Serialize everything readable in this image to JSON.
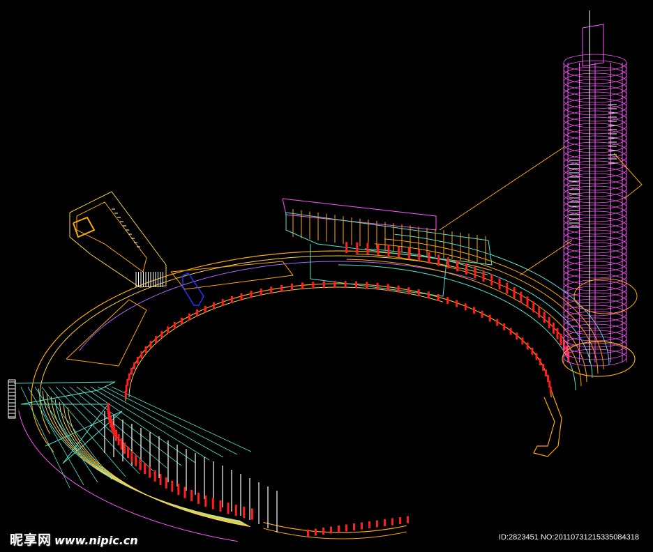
{
  "watermark": {
    "logo_text": "昵享网",
    "site_text": "www.nipic.cn",
    "id_text": "ID:2823451 NO:20110731215335084318"
  },
  "colors": {
    "background": "#000000",
    "orange": "#ffaa00",
    "yellow": "#ffd24a",
    "red": "#ff1e1e",
    "magenta": "#ff55ff",
    "violet": "#aa66ff",
    "cyan": "#55e6d2",
    "white": "#ffffff",
    "blue": "#2233ff"
  }
}
